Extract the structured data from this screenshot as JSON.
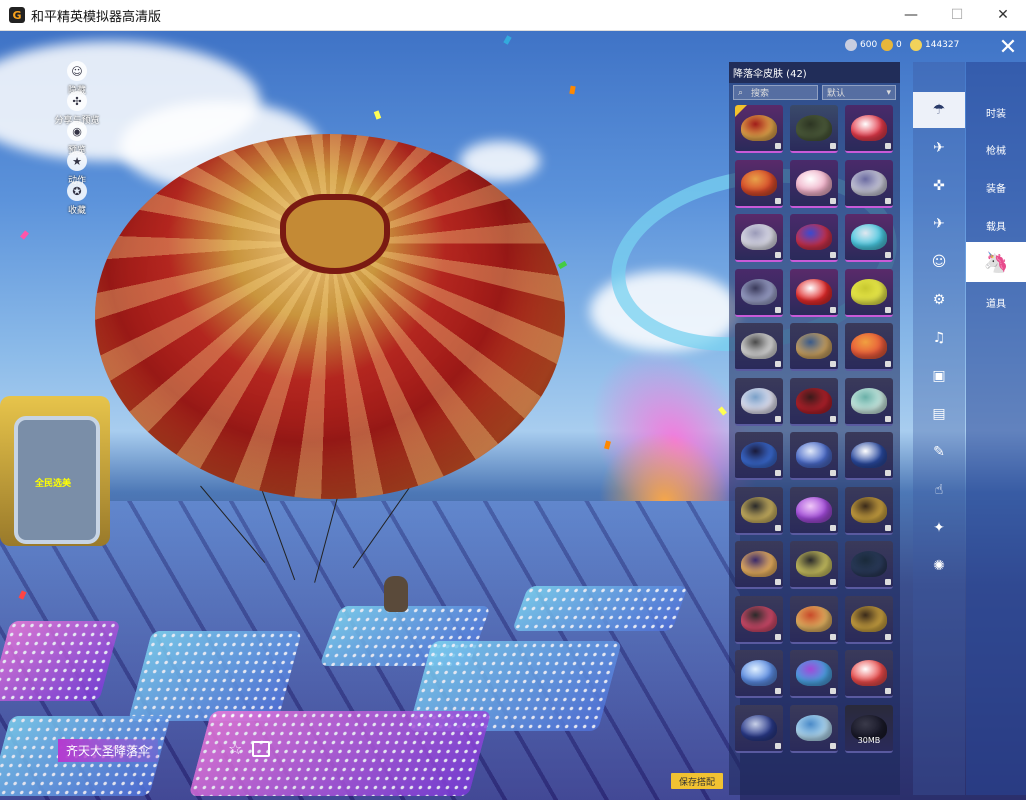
{
  "window": {
    "title": "和平精英模拟器高清版",
    "minimize": "—",
    "maximize": "☐",
    "close": "✕"
  },
  "currency": {
    "silver": "600",
    "ticket": "0",
    "gold": "144327"
  },
  "left_menu": [
    {
      "icon": "user-icon",
      "label": "隐藏"
    },
    {
      "icon": "share-icon",
      "label": "分享与预览"
    },
    {
      "icon": "eye-icon",
      "label": "预览"
    },
    {
      "icon": "star-icon",
      "label": "动作"
    },
    {
      "icon": "medal-icon",
      "label": "收藏"
    }
  ],
  "booth_text": "全民选美",
  "panel": {
    "title": "降落伞皮肤 (42)",
    "search_placeholder": "搜索",
    "sort": "默认"
  },
  "skins": [
    {
      "c1": "#e0a34a",
      "c2": "#a11d1a",
      "bg": "#5a2a6a",
      "gold": true
    },
    {
      "c1": "#4b5a3a",
      "c2": "#2d3523",
      "bg": "#3a4a6a"
    },
    {
      "c1": "#e23a4a",
      "c2": "#ffffff",
      "bg": "#4a2a6a"
    },
    {
      "c1": "#d74a2a",
      "c2": "#e7a24a",
      "bg": "#5a2a6a"
    },
    {
      "c1": "#f0b0c8",
      "c2": "#ffffff",
      "bg": "#4a2a6a"
    },
    {
      "c1": "#c8c8d8",
      "c2": "#6a6aa0",
      "bg": "#4a2a6a"
    },
    {
      "c1": "#dcdce8",
      "c2": "#9a9ab8",
      "bg": "#5a2a6a"
    },
    {
      "c1": "#c8304a",
      "c2": "#3a4ad0",
      "bg": "#4a2a6a"
    },
    {
      "c1": "#4ac8e0",
      "c2": "#e0e8f0",
      "bg": "#5a2a6a"
    },
    {
      "c1": "#9aa0c8",
      "c2": "#3a3a5a",
      "bg": "#4a2a6a"
    },
    {
      "c1": "#e02a2a",
      "c2": "#ffffff",
      "bg": "#5a2a6a"
    },
    {
      "c1": "#e8e84a",
      "c2": "#c8c830",
      "bg": "#5a2a6a"
    },
    {
      "c1": "#d8d8d8",
      "c2": "#4a4a4a",
      "bg": "#3a3a5a"
    },
    {
      "c1": "#c8a060",
      "c2": "#3a5a8a",
      "bg": "#3a3a5a"
    },
    {
      "c1": "#e85a3a",
      "c2": "#f0a040",
      "bg": "#3a3a5a"
    },
    {
      "c1": "#e0e0f0",
      "c2": "#7aa0c8",
      "bg": "#3a3a5a"
    },
    {
      "c1": "#b0202a",
      "c2": "#3a1a1a",
      "bg": "#3a3a5a"
    },
    {
      "c1": "#c8e8e0",
      "c2": "#6ab0a8",
      "bg": "#3a3a5a"
    },
    {
      "c1": "#3a6ad0",
      "c2": "#1a1a3a",
      "bg": "#3a3a5a"
    },
    {
      "c1": "#4a6ac8",
      "c2": "#e0e8f8",
      "bg": "#3a3a5a"
    },
    {
      "c1": "#2a4aa0",
      "c2": "#ffffff",
      "bg": "#3a3a5a"
    },
    {
      "c1": "#c8b060",
      "c2": "#2a2a2a",
      "bg": "#3a3a5a"
    },
    {
      "c1": "#a04ad8",
      "c2": "#f0c8f8",
      "bg": "#3a3a5a"
    },
    {
      "c1": "#c8a040",
      "c2": "#3a2a1a",
      "bg": "#3a3a5a"
    },
    {
      "c1": "#e8b060",
      "c2": "#3a2a6a",
      "bg": "#3a3a5a"
    },
    {
      "c1": "#c8c060",
      "c2": "#2a2a2a",
      "bg": "#3a3a5a"
    },
    {
      "c1": "#2a3a5a",
      "c2": "#1a2a3a",
      "bg": "#3a3a5a"
    },
    {
      "c1": "#d04a6a",
      "c2": "#2a2a2a",
      "bg": "#3a3a5a"
    },
    {
      "c1": "#e0b060",
      "c2": "#c84a2a",
      "bg": "#3a3a5a"
    },
    {
      "c1": "#c8a040",
      "c2": "#3a2a1a",
      "bg": "#3a3a5a"
    },
    {
      "c1": "#5a8ae0",
      "c2": "#e0f0ff",
      "bg": "#3a3a5a"
    },
    {
      "c1": "#4aa0e0",
      "c2": "#a04ad8",
      "bg": "#3a3a5a"
    },
    {
      "c1": "#e84a4a",
      "c2": "#ffffff",
      "bg": "#3a3a5a"
    },
    {
      "c1": "#2a3a8a",
      "c2": "#c8d0e8",
      "bg": "#3a3a5a"
    },
    {
      "c1": "#b0d8f0",
      "c2": "#4a8ac8",
      "bg": "#3a3a5a"
    },
    {
      "c1": "#1a1a2a",
      "c2": "#3a3a4a",
      "bg": "#2a2a3a",
      "label": "30MB"
    }
  ],
  "icon_tabs": [
    "parachute-icon",
    "glider-icon",
    "drone-icon",
    "plane-icon",
    "emoji-icon",
    "robot-icon",
    "speaker-icon",
    "frame-icon",
    "photo-icon",
    "spray-icon",
    "finger-icon",
    "wand-icon",
    "effect-icon"
  ],
  "categories": [
    "时装",
    "枪械",
    "装备",
    "载具",
    "",
    "道具"
  ],
  "item_name": "齐天大圣降落伞",
  "save_button": "保存搭配"
}
